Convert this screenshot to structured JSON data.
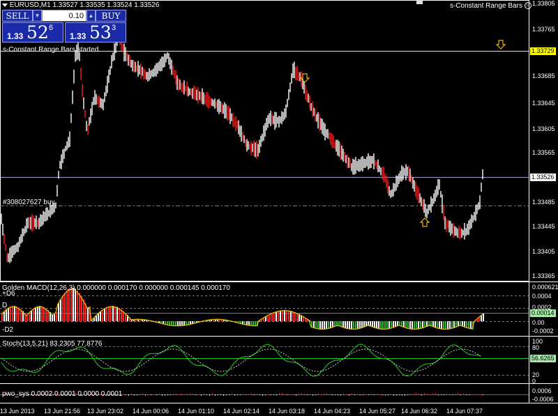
{
  "header": {
    "symbol_info": "EURUSD,M1  1.33527 1.33535 1.33524 1.33526",
    "indicator_name": "s-Constant Range Bars",
    "status_text": "s-Constant Range Bars started",
    "smiley_icon": "smiley-icon"
  },
  "trade_panel": {
    "sell_label": "SELL",
    "buy_label": "BUY",
    "lot_value": "0.10",
    "sell_prefix": "1.33",
    "sell_big": "52",
    "sell_sup": "6",
    "buy_prefix": "1.33",
    "buy_big": "53",
    "buy_sup": "3"
  },
  "order_label": "#308027627 buy",
  "price_axis": [
    "1.33805",
    "1.33765",
    "1.33729",
    "1.33685",
    "1.33645",
    "1.33605",
    "1.33565",
    "1.33526",
    "1.33485",
    "1.33445",
    "1.33405",
    "1.33365"
  ],
  "price_highlight": {
    "upper": "1.33729",
    "current": "1.33526"
  },
  "macd": {
    "title": "Golden MACD(12,26,3) 0.000000 0.000170 0.000000 0.000145 0.000170",
    "plus_label": "+D6",
    "d_label": "D",
    "minus_label": "-D2",
    "axis": [
      "0.000621",
      "0.0004",
      "0.0002",
      "0.00",
      "-0.0002"
    ],
    "highlight": "0.00014"
  },
  "stoch": {
    "title": "Stoch(13,5,21) 83.2305 77.8776",
    "axis": [
      "100",
      "80",
      "20",
      "0"
    ],
    "highlight": "56.6265"
  },
  "pwo": {
    "title": "pwo_sys 0.0002 0.0001 0.0000 0.0001",
    "axis": [
      "0.0006",
      "-0.0006"
    ]
  },
  "time_axis": [
    "13 Jun 2013",
    "13 Jun 21:56",
    "13 Jun 23:02",
    "14 Jun 00:06",
    "14 Jun 01:10",
    "14 Jun 02:14",
    "14 Jun 03:18",
    "14 Jun 04:23",
    "14 Jun 05:27",
    "14 Jun 06:32",
    "14 Jun 07:37"
  ],
  "colors": {
    "bull": "#ffffff",
    "bear": "#ff1a1a",
    "level_line": "#e8e8a0",
    "order_line": "#1fc31f",
    "highlight_yellow": "#ffff00",
    "highlight_green": "#a6e8a6"
  }
}
